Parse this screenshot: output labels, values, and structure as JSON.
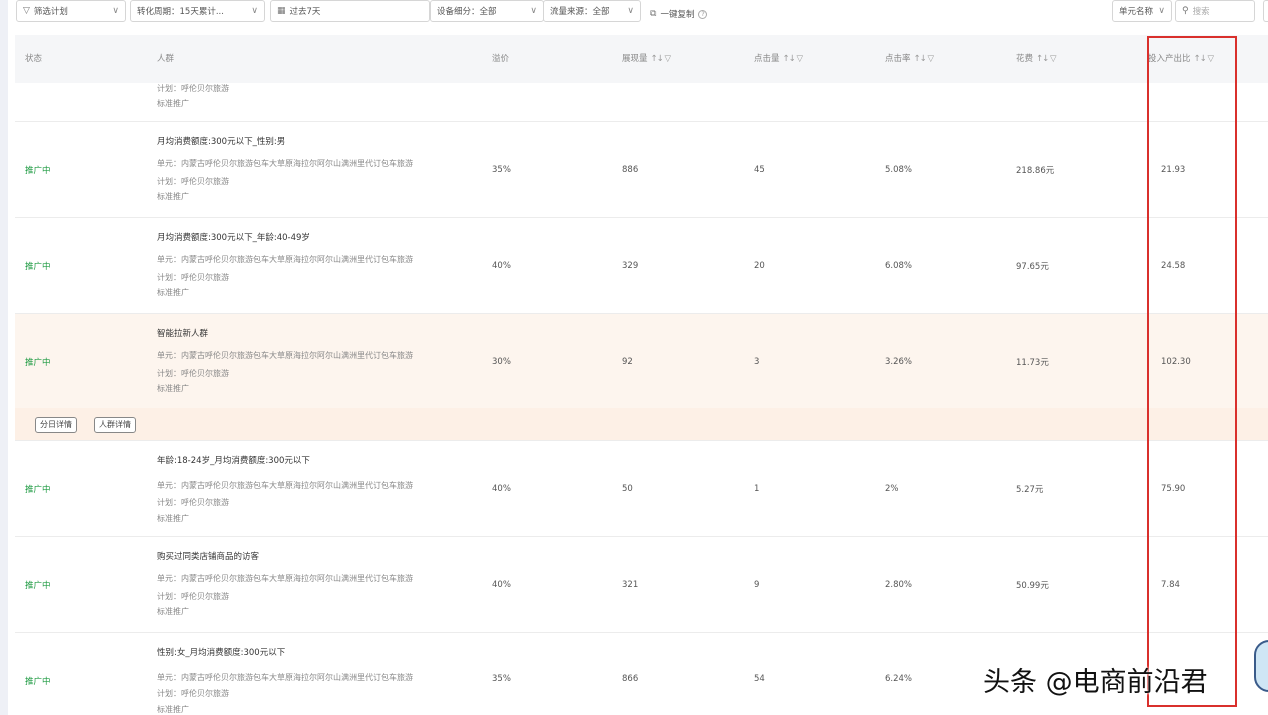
{
  "toolbar": {
    "filter_plan": "筛选计划",
    "conversion": "转化周期：15天累计...",
    "date": "过去7天",
    "device": "设备细分：全部",
    "traffic": "流量来源：全部",
    "copy": "一键复制",
    "unit_select": "单元名称",
    "search_placeholder": "搜索"
  },
  "headers": {
    "status": "状态",
    "crowd": "人群",
    "premium": "溢价",
    "impressions": "展现量",
    "clicks": "点击量",
    "ctr": "点击率",
    "cost": "花费",
    "roi": "投入产出比"
  },
  "partial_row": {
    "plan": "计划：呼伦贝尔旅游",
    "type": "标准推广"
  },
  "rows": [
    {
      "status": "推广中",
      "name": "月均消费额度:300元以下_性别:男",
      "unit": "单元：内蒙古呼伦贝尔旅游包车大草原海拉尔阿尔山满洲里代订包车旅游",
      "plan": "计划：呼伦贝尔旅游",
      "type": "标准推广",
      "premium": "35%",
      "impressions": "886",
      "clicks": "45",
      "ctr": "5.08%",
      "cost": "218.86元",
      "roi": "21.93"
    },
    {
      "status": "推广中",
      "name": "月均消费额度:300元以下_年龄:40-49岁",
      "unit": "单元：内蒙古呼伦贝尔旅游包车大草原海拉尔阿尔山满洲里代订包车旅游",
      "plan": "计划：呼伦贝尔旅游",
      "type": "标准推广",
      "premium": "40%",
      "impressions": "329",
      "clicks": "20",
      "ctr": "6.08%",
      "cost": "97.65元",
      "roi": "24.58"
    },
    {
      "status": "推广中",
      "name": "智能拉新人群",
      "unit": "单元：内蒙古呼伦贝尔旅游包车大草原海拉尔阿尔山满洲里代订包车旅游",
      "plan": "计划：呼伦贝尔旅游",
      "type": "标准推广",
      "premium": "30%",
      "impressions": "92",
      "clicks": "3",
      "ctr": "3.26%",
      "cost": "11.73元",
      "roi": "102.30"
    },
    {
      "status": "推广中",
      "name": "年龄:18-24岁_月均消费额度:300元以下",
      "unit": "单元：内蒙古呼伦贝尔旅游包车大草原海拉尔阿尔山满洲里代订包车旅游",
      "plan": "计划：呼伦贝尔旅游",
      "type": "标准推广",
      "premium": "40%",
      "impressions": "50",
      "clicks": "1",
      "ctr": "2%",
      "cost": "5.27元",
      "roi": "75.90"
    },
    {
      "status": "推广中",
      "name": "购买过同类店铺商品的访客",
      "unit": "单元：内蒙古呼伦贝尔旅游包车大草原海拉尔阿尔山满洲里代订包车旅游",
      "plan": "计划：呼伦贝尔旅游",
      "type": "标准推广",
      "premium": "40%",
      "impressions": "321",
      "clicks": "9",
      "ctr": "2.80%",
      "cost": "50.99元",
      "roi": "7.84"
    },
    {
      "status": "推广中",
      "name": "性别:女_月均消费额度:300元以下",
      "unit": "单元：内蒙古呼伦贝尔旅游包车大草原海拉尔阿尔山满洲里代订包车旅游",
      "plan": "计划：呼伦贝尔旅游",
      "type": "标准推广",
      "premium": "35%",
      "impressions": "866",
      "clicks": "54",
      "ctr": "6.24%",
      "cost": "",
      "roi": ""
    }
  ],
  "actions": {
    "daily": "分日详情",
    "crowd_detail": "人群详情"
  },
  "watermark": "头条 @电商前沿君",
  "colors": {
    "status_green": "#1d9a41",
    "highlight_row": "#fdf5ee",
    "red_box": "#d9302c"
  }
}
